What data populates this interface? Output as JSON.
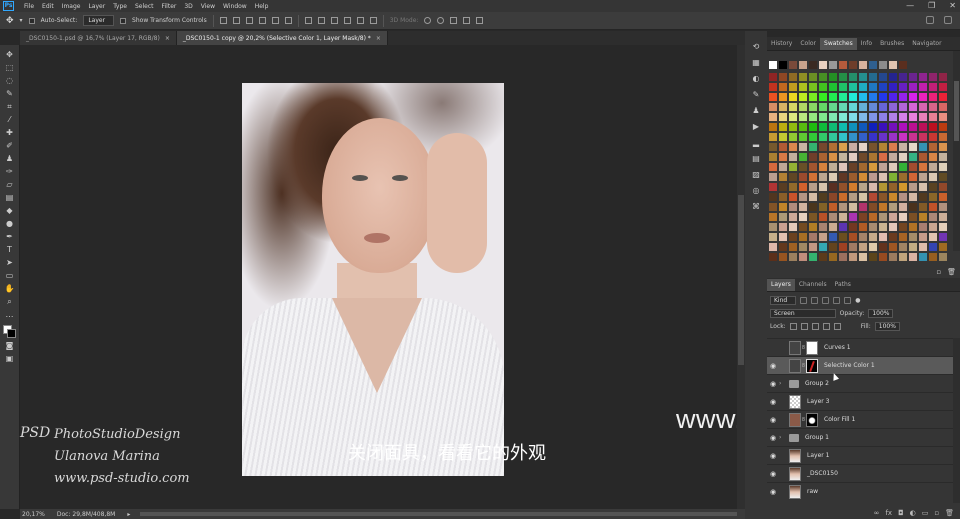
{
  "app": {
    "logo": "Ps"
  },
  "menu": [
    "File",
    "Edit",
    "Image",
    "Layer",
    "Type",
    "Select",
    "Filter",
    "3D",
    "View",
    "Window",
    "Help"
  ],
  "window_controls": {
    "minimize": "—",
    "restore": "❐",
    "close": "✕"
  },
  "options": {
    "auto_select_label": "Auto-Select:",
    "auto_select_value": "Layer",
    "transform_label": "Show Transform Controls",
    "mode3d_label": "3D Mode:"
  },
  "tabs": [
    {
      "label": "_DSC0150-1.psd @ 16,7% (Layer 17, RGB/8)",
      "close": "×"
    },
    {
      "label": "_DSC0150-1 copy @ 20,2% (Selective Color 1, Layer Mask/8) *",
      "close": "×"
    }
  ],
  "watermark": {
    "logo": "PSD",
    "line1": "PhotoStudioDesign",
    "line2": "Ulanova Marina",
    "line3": "www.psd-studio.com"
  },
  "site_watermark": "www.hunls.com",
  "subtitle": "关闭面具，看看它的外观",
  "status": {
    "zoom": "20,17%",
    "doc": "Doc: 29,8M/408,8M"
  },
  "top_panel": {
    "tabs": [
      "History",
      "Color",
      "Swatches",
      "Info",
      "Brushes",
      "Navigator"
    ],
    "active": "Swatches"
  },
  "layers_panel": {
    "tabs": [
      "Layers",
      "Channels",
      "Paths"
    ],
    "filter_kind": "Kind",
    "blend_mode": "Screen",
    "opacity_label": "Opacity:",
    "opacity_value": "100%",
    "lock_label": "Lock:",
    "fill_label": "Fill:",
    "fill_value": "100%",
    "layers": [
      {
        "name": "Curves 1",
        "type": "adjustment",
        "visible": false,
        "selected": false
      },
      {
        "name": "Selective Color 1",
        "type": "adjustment",
        "visible": true,
        "selected": true
      },
      {
        "name": "Group 2",
        "type": "group",
        "visible": true,
        "selected": false
      },
      {
        "name": "Layer 3",
        "type": "pixel",
        "visible": true,
        "selected": false
      },
      {
        "name": "Color Fill 1",
        "type": "fill",
        "visible": true,
        "selected": false
      },
      {
        "name": "Group 1",
        "type": "group",
        "visible": true,
        "selected": false
      },
      {
        "name": "Layer 1",
        "type": "pixel",
        "visible": true,
        "selected": false
      },
      {
        "name": "_DSC0150",
        "type": "pixel",
        "visible": true,
        "selected": false
      },
      {
        "name": "raw",
        "type": "pixel",
        "visible": true,
        "selected": false
      }
    ]
  },
  "colors": {
    "foreground": "#ffffff",
    "background": "#000000",
    "selected_row": "#5a5a5a",
    "color_fill_thumb": "#8a5a48"
  }
}
